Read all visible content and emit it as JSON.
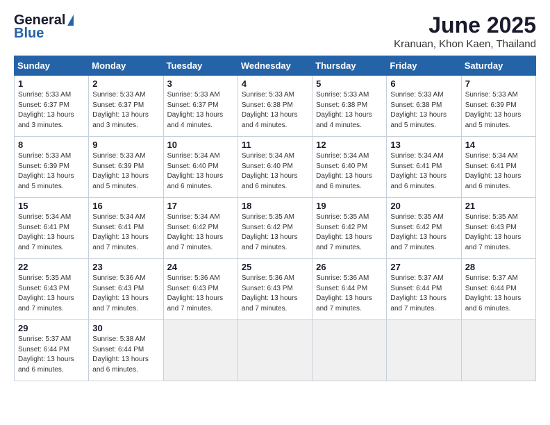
{
  "header": {
    "logo_general": "General",
    "logo_blue": "Blue",
    "month_title": "June 2025",
    "location": "Kranuan, Khon Kaen, Thailand"
  },
  "weekdays": [
    "Sunday",
    "Monday",
    "Tuesday",
    "Wednesday",
    "Thursday",
    "Friday",
    "Saturday"
  ],
  "weeks": [
    [
      {
        "day": "1",
        "lines": [
          "Sunrise: 5:33 AM",
          "Sunset: 6:37 PM",
          "Daylight: 13 hours",
          "and 3 minutes."
        ]
      },
      {
        "day": "2",
        "lines": [
          "Sunrise: 5:33 AM",
          "Sunset: 6:37 PM",
          "Daylight: 13 hours",
          "and 3 minutes."
        ]
      },
      {
        "day": "3",
        "lines": [
          "Sunrise: 5:33 AM",
          "Sunset: 6:37 PM",
          "Daylight: 13 hours",
          "and 4 minutes."
        ]
      },
      {
        "day": "4",
        "lines": [
          "Sunrise: 5:33 AM",
          "Sunset: 6:38 PM",
          "Daylight: 13 hours",
          "and 4 minutes."
        ]
      },
      {
        "day": "5",
        "lines": [
          "Sunrise: 5:33 AM",
          "Sunset: 6:38 PM",
          "Daylight: 13 hours",
          "and 4 minutes."
        ]
      },
      {
        "day": "6",
        "lines": [
          "Sunrise: 5:33 AM",
          "Sunset: 6:38 PM",
          "Daylight: 13 hours",
          "and 5 minutes."
        ]
      },
      {
        "day": "7",
        "lines": [
          "Sunrise: 5:33 AM",
          "Sunset: 6:39 PM",
          "Daylight: 13 hours",
          "and 5 minutes."
        ]
      }
    ],
    [
      {
        "day": "8",
        "lines": [
          "Sunrise: 5:33 AM",
          "Sunset: 6:39 PM",
          "Daylight: 13 hours",
          "and 5 minutes."
        ]
      },
      {
        "day": "9",
        "lines": [
          "Sunrise: 5:33 AM",
          "Sunset: 6:39 PM",
          "Daylight: 13 hours",
          "and 5 minutes."
        ]
      },
      {
        "day": "10",
        "lines": [
          "Sunrise: 5:34 AM",
          "Sunset: 6:40 PM",
          "Daylight: 13 hours",
          "and 6 minutes."
        ]
      },
      {
        "day": "11",
        "lines": [
          "Sunrise: 5:34 AM",
          "Sunset: 6:40 PM",
          "Daylight: 13 hours",
          "and 6 minutes."
        ]
      },
      {
        "day": "12",
        "lines": [
          "Sunrise: 5:34 AM",
          "Sunset: 6:40 PM",
          "Daylight: 13 hours",
          "and 6 minutes."
        ]
      },
      {
        "day": "13",
        "lines": [
          "Sunrise: 5:34 AM",
          "Sunset: 6:41 PM",
          "Daylight: 13 hours",
          "and 6 minutes."
        ]
      },
      {
        "day": "14",
        "lines": [
          "Sunrise: 5:34 AM",
          "Sunset: 6:41 PM",
          "Daylight: 13 hours",
          "and 6 minutes."
        ]
      }
    ],
    [
      {
        "day": "15",
        "lines": [
          "Sunrise: 5:34 AM",
          "Sunset: 6:41 PM",
          "Daylight: 13 hours",
          "and 7 minutes."
        ]
      },
      {
        "day": "16",
        "lines": [
          "Sunrise: 5:34 AM",
          "Sunset: 6:41 PM",
          "Daylight: 13 hours",
          "and 7 minutes."
        ]
      },
      {
        "day": "17",
        "lines": [
          "Sunrise: 5:34 AM",
          "Sunset: 6:42 PM",
          "Daylight: 13 hours",
          "and 7 minutes."
        ]
      },
      {
        "day": "18",
        "lines": [
          "Sunrise: 5:35 AM",
          "Sunset: 6:42 PM",
          "Daylight: 13 hours",
          "and 7 minutes."
        ]
      },
      {
        "day": "19",
        "lines": [
          "Sunrise: 5:35 AM",
          "Sunset: 6:42 PM",
          "Daylight: 13 hours",
          "and 7 minutes."
        ]
      },
      {
        "day": "20",
        "lines": [
          "Sunrise: 5:35 AM",
          "Sunset: 6:42 PM",
          "Daylight: 13 hours",
          "and 7 minutes."
        ]
      },
      {
        "day": "21",
        "lines": [
          "Sunrise: 5:35 AM",
          "Sunset: 6:43 PM",
          "Daylight: 13 hours",
          "and 7 minutes."
        ]
      }
    ],
    [
      {
        "day": "22",
        "lines": [
          "Sunrise: 5:35 AM",
          "Sunset: 6:43 PM",
          "Daylight: 13 hours",
          "and 7 minutes."
        ]
      },
      {
        "day": "23",
        "lines": [
          "Sunrise: 5:36 AM",
          "Sunset: 6:43 PM",
          "Daylight: 13 hours",
          "and 7 minutes."
        ]
      },
      {
        "day": "24",
        "lines": [
          "Sunrise: 5:36 AM",
          "Sunset: 6:43 PM",
          "Daylight: 13 hours",
          "and 7 minutes."
        ]
      },
      {
        "day": "25",
        "lines": [
          "Sunrise: 5:36 AM",
          "Sunset: 6:43 PM",
          "Daylight: 13 hours",
          "and 7 minutes."
        ]
      },
      {
        "day": "26",
        "lines": [
          "Sunrise: 5:36 AM",
          "Sunset: 6:44 PM",
          "Daylight: 13 hours",
          "and 7 minutes."
        ]
      },
      {
        "day": "27",
        "lines": [
          "Sunrise: 5:37 AM",
          "Sunset: 6:44 PM",
          "Daylight: 13 hours",
          "and 7 minutes."
        ]
      },
      {
        "day": "28",
        "lines": [
          "Sunrise: 5:37 AM",
          "Sunset: 6:44 PM",
          "Daylight: 13 hours",
          "and 6 minutes."
        ]
      }
    ],
    [
      {
        "day": "29",
        "lines": [
          "Sunrise: 5:37 AM",
          "Sunset: 6:44 PM",
          "Daylight: 13 hours",
          "and 6 minutes."
        ]
      },
      {
        "day": "30",
        "lines": [
          "Sunrise: 5:38 AM",
          "Sunset: 6:44 PM",
          "Daylight: 13 hours",
          "and 6 minutes."
        ]
      },
      null,
      null,
      null,
      null,
      null
    ]
  ]
}
